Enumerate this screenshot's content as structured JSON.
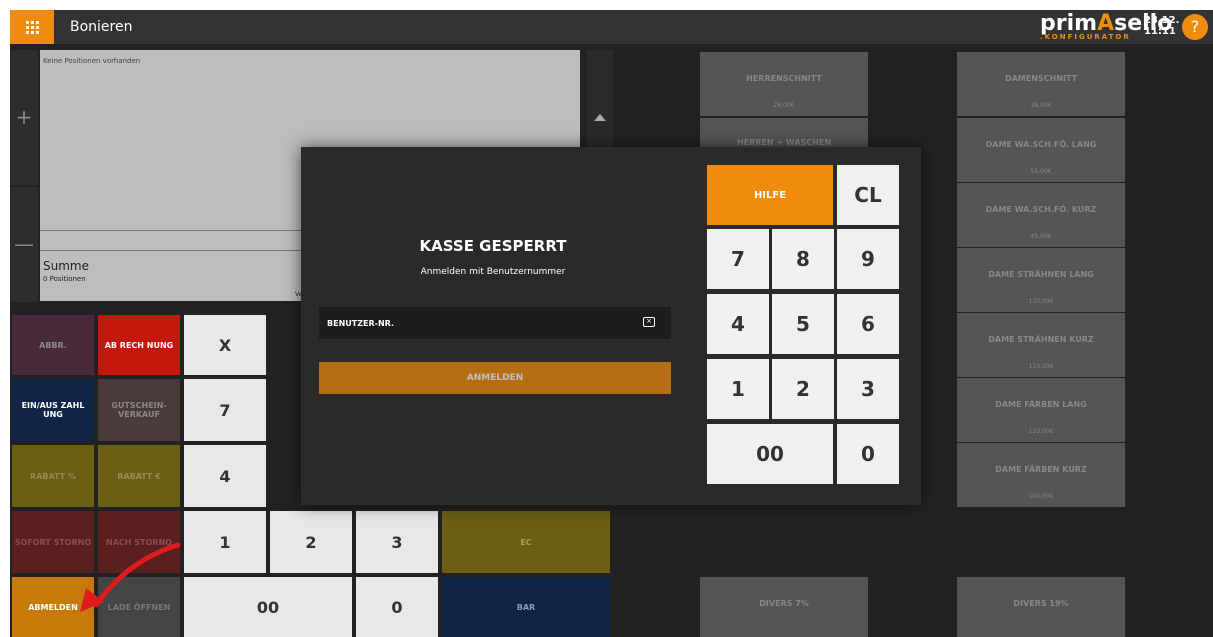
{
  "header": {
    "title": "Bonieren",
    "brand_prefix": "prim",
    "brand_accent": "A",
    "brand_suffix": "sello",
    "brand_sub": ".KONFIGURATOR",
    "date": "23.12.",
    "time": "11:11",
    "help": "?"
  },
  "side": {
    "plus": "+",
    "minus": "—"
  },
  "positions": {
    "empty": "Keine Positionen vorhanden",
    "sum_label": "Summe",
    "count": "0 Positionen",
    "footer_fragment": "Ve"
  },
  "buttons": {
    "abbr": "ABBR.",
    "abrechnung": "AB RECH NUNG",
    "x": "X",
    "einaus": "EIN/AUS ZAHL UNG",
    "gutschein": "GUTSCHEIN-VERKAUF",
    "seven": "7",
    "rabatt_pct": "RABATT %",
    "rabatt_eur": "RABATT €",
    "four": "4",
    "sofort": "SOFORT STORNO",
    "nach": "NACH STORNO",
    "one": "1",
    "two": "2",
    "three": "3",
    "ec": "EC",
    "abmelden": "ABMELDEN",
    "lade": "LADE ÖFFNEN",
    "zeros": "00",
    "zero": "0",
    "bar": "BAR"
  },
  "products": [
    {
      "name": "HERRENSCHNITT",
      "price": "26,00€"
    },
    {
      "name": "HERREN + WASCHEN",
      "price": ""
    },
    {
      "name": "DAMENSCHNITT",
      "price": "38,00€"
    },
    {
      "name": "DAME WA.SCH.FÖ. LANG",
      "price": "55,00€"
    },
    {
      "name": "DAME WA.SCH.FÖ. KURZ",
      "price": "45,00€"
    },
    {
      "name": "DAME STRÄHNEN LANG",
      "price": "130,00€"
    },
    {
      "name": "DAME STRÄHNEN KURZ",
      "price": "110,00€"
    },
    {
      "name": "DAME FÄRBEN LANG",
      "price": "120,00€"
    },
    {
      "name": "DAME FÄRBEN KURZ",
      "price": "100,00€"
    },
    {
      "name": "DIVERS 7%",
      "price": ""
    },
    {
      "name": "DIVERS 19%",
      "price": ""
    }
  ],
  "modal": {
    "title": "KASSE GESPERRT",
    "subtitle": "Anmelden mit Benutzernummer",
    "placeholder": "BENUTZER-NR.",
    "login": "ANMELDEN",
    "backspace": "×"
  },
  "keypad": {
    "hilfe": "HILFE",
    "cl": "CL",
    "k7": "7",
    "k8": "8",
    "k9": "9",
    "k4": "4",
    "k5": "5",
    "k6": "6",
    "k1": "1",
    "k2": "2",
    "k3": "3",
    "k00": "00",
    "k0": "0"
  },
  "colors": {
    "accent": "#ef8c0b",
    "red": "#c4180f",
    "navy": "#0f2447",
    "olive": "#6b5f16",
    "arrow": "#e01b1b"
  }
}
